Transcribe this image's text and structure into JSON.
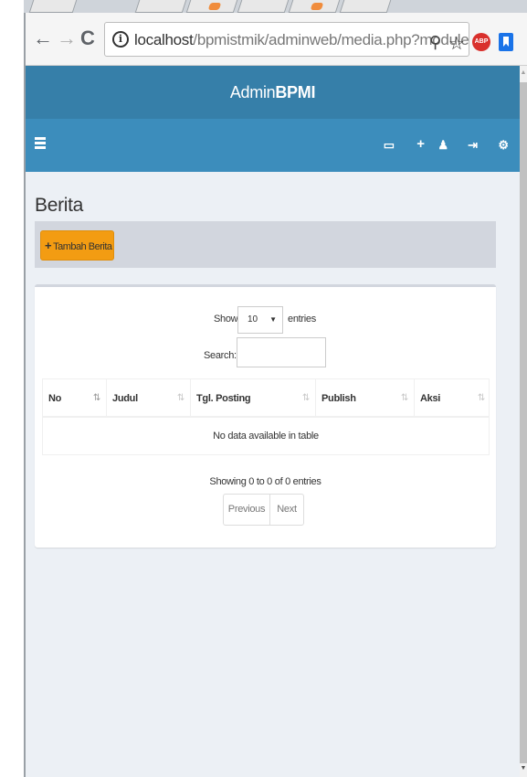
{
  "browser": {
    "url_host": "localhost",
    "url_path": "/bpmistmik/adminweb/media.php?module",
    "nav_back": "←",
    "nav_forward": "→",
    "nav_reload": "C",
    "info_glyph": "i",
    "zoom_glyph": "⚲",
    "star_glyph": "☆",
    "abp_label": "ABP",
    "menu_glyph": "⋮"
  },
  "header": {
    "logo_light": "Admin",
    "logo_bold": "BPMI"
  },
  "content": {
    "title": "Berita",
    "add_button": "Tambah Berita",
    "add_button_icon": "+"
  },
  "table_controls": {
    "show_label": "Show",
    "show_value": "10",
    "show_caret": "▼",
    "entries_label": "entries",
    "search_label": "Search:"
  },
  "table": {
    "columns": [
      "No",
      "Judul",
      "Tgl. Posting",
      "Publish",
      "Aksi"
    ],
    "sort_glyph": "⇅",
    "empty_message": "No data available in table"
  },
  "footer": {
    "info": "Showing 0 to 0 of 0 entries",
    "prev": "Previous",
    "next": "Next"
  },
  "scrollbar": {
    "up_glyph": "▲",
    "down_glyph": "▼"
  },
  "colors": {
    "logo_bar": "#367fa9",
    "navbar": "#3c8dbc",
    "add_button": "#f39c12",
    "content_bg": "#ecf0f5"
  }
}
